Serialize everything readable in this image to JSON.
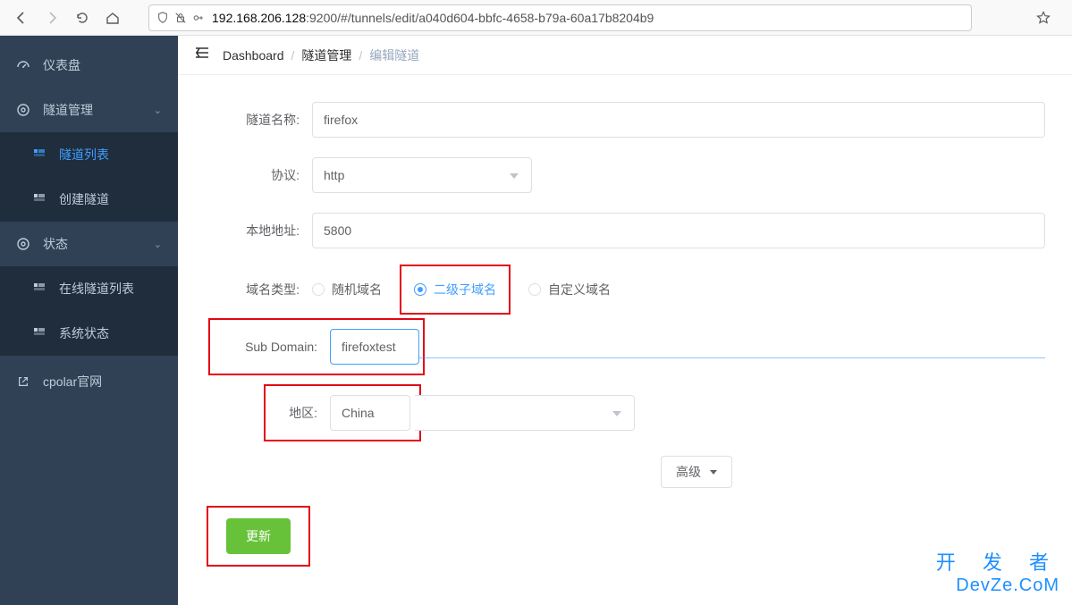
{
  "browser": {
    "url_dark": "192.168.206.128",
    "url_rest": ":9200/#/tunnels/edit/a040d604-bbfc-4658-b79a-60a17b8204b9"
  },
  "sidebar": {
    "items": [
      {
        "label": "仪表盘",
        "icon": "gauge"
      },
      {
        "label": "隧道管理",
        "icon": "target",
        "expandable": true
      },
      {
        "label": "隧道列表",
        "icon": "grid",
        "sub": true,
        "active": true
      },
      {
        "label": "创建隧道",
        "icon": "grid",
        "sub": true
      },
      {
        "label": "状态",
        "icon": "target",
        "expandable": true
      },
      {
        "label": "在线隧道列表",
        "icon": "grid",
        "sub": true
      },
      {
        "label": "系统状态",
        "icon": "grid",
        "sub": true
      },
      {
        "label": "cpolar官网",
        "icon": "link"
      }
    ]
  },
  "breadcrumb": {
    "root": "Dashboard",
    "mid": "隧道管理",
    "current": "编辑隧道"
  },
  "form": {
    "name_label": "隧道名称:",
    "name_value": "firefox",
    "proto_label": "协议:",
    "proto_value": "http",
    "addr_label": "本地地址:",
    "addr_value": "5800",
    "domain_type_label": "域名类型:",
    "domain_options": [
      "随机域名",
      "二级子域名",
      "自定义域名"
    ],
    "domain_selected_index": 1,
    "subdomain_label": "Sub Domain:",
    "subdomain_value": "firefoxtest",
    "region_label": "地区:",
    "region_value": "China",
    "advanced_label": "高级",
    "submit_label": "更新"
  },
  "watermark": {
    "line1": "开 发 者",
    "line2": "DevZe.CoM"
  }
}
